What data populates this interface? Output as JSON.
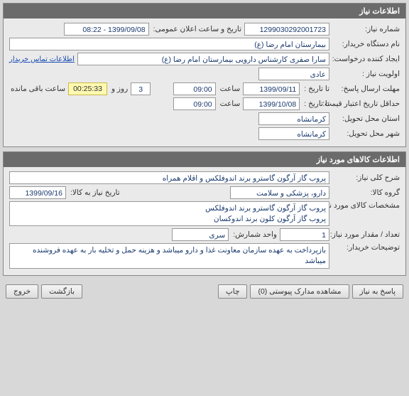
{
  "panel1": {
    "title": "اطلاعات نیاز",
    "req_no_label": "شماره نیاز:",
    "req_no": "1299030292001723",
    "announce_label": "تاریخ و ساعت اعلان عمومی:",
    "announce_value": "1399/09/08 - 08:22",
    "org_label": "نام دستگاه خریدار:",
    "org_value": "بیمارستان امام رضا (ع)",
    "creator_label": "ایجاد کننده درخواست:",
    "creator_value": "سارا صفری کارشناس دارویی بیمارستان امام رضا (ع)",
    "contact_link": "اطلاعات تماس خریدار",
    "priority_label": "اولویت نیاز :",
    "priority_value": "عادی",
    "deadline_label": "مهلت ارسال پاسخ:",
    "until_label": "تا تاریخ :",
    "until_date": "1399/09/11",
    "time_label": "ساعت",
    "until_time": "09:00",
    "days_value": "3",
    "days_label": "روز و",
    "countdown": "00:25:33",
    "remaining_label": "ساعت باقی مانده",
    "min_valid_label": "حداقل تاریخ اعتبار قیمت:",
    "min_valid_until_label": "تا تاریخ :",
    "min_valid_date": "1399/10/08",
    "min_valid_time": "09:00",
    "province_label": "استان محل تحویل:",
    "province_value": "کرمانشاه",
    "city_label": "شهر محل تحویل:",
    "city_value": "کرمانشاه"
  },
  "panel2": {
    "title": "اطلاعات کالاهای مورد نیاز",
    "desc_label": "شرح کلی نیاز:",
    "desc_value": "پروب گاز آرگون گاسترو برند اندوفلکس و اقلام همراه",
    "group_label": "گروه کالا:",
    "group_value": "دارو، پزشکی و سلامت",
    "need_date_label": "تاریخ نیاز به کالا:",
    "need_date_value": "1399/09/16",
    "spec_label": "مشخصات کالای مورد نیاز:",
    "spec_value": "پروب گاز آرگون گاسترو برند اندوفلکس\nپروب گاز آرگون کلون برند اندوکسان",
    "qty_label": "تعداد / مقدار مورد نیاز:",
    "qty_value": "1",
    "unit_label": "واحد شمارش:",
    "unit_value": "سری",
    "notes_label": "توضیحات خریدار:",
    "notes_value": "بازپرداخت به عهده سازمان معاونت غذا و دارو میباشد و هزینه حمل و تخلیه بار به عهده فروشنده میباشد"
  },
  "footer": {
    "reply": "پاسخ به نیاز",
    "attachments": "مشاهده مدارک پیوستی (0)",
    "print": "چاپ",
    "back": "بازگشت",
    "exit": "خروج"
  }
}
